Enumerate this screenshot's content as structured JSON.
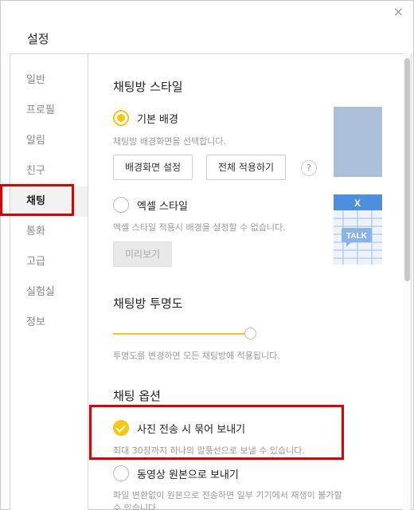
{
  "window": {
    "title": "설정",
    "close_glyph": "×"
  },
  "sidebar": {
    "items": [
      {
        "label": "일반"
      },
      {
        "label": "프로필"
      },
      {
        "label": "알림"
      },
      {
        "label": "친구"
      },
      {
        "label": "채팅",
        "active": true
      },
      {
        "label": "통화"
      },
      {
        "label": "고급"
      },
      {
        "label": "실험실"
      },
      {
        "label": "정보"
      }
    ]
  },
  "style_section": {
    "title": "채팅방 스타일",
    "basic": {
      "label": "기본 배경",
      "selected": true,
      "desc": "채팅방 배경화면을 선택합니다."
    },
    "set_background_button": "배경화면 설정",
    "apply_all_button": "전체 적용하기",
    "help_glyph": "?",
    "excel": {
      "label": "엑셀 스타일",
      "selected": false,
      "desc": "엑셀 스타일 적용시 배경을 설정할 수 없습니다."
    },
    "preview_button": "미리보기",
    "excel_thumb": {
      "header_glyph": "X",
      "talk_text": "TALK"
    }
  },
  "opacity_section": {
    "title": "채팅방 투명도",
    "value_percent": 100,
    "desc": "투명도를 변경하면 모든 채팅방에 적용됩니다."
  },
  "options_section": {
    "title": "채팅 옵션",
    "photo_bundle": {
      "label": "사진 전송 시 묶어 보내기",
      "checked": true,
      "desc": "최대 30장까지 하나의 말풍선으로 보낼 수 있습니다."
    },
    "video_original": {
      "label": "동영상 원본으로 보내기",
      "checked": false,
      "desc_line1": "파일 변환없이 원본으로 전송하면 일부 기기에서 재생이 불가할",
      "desc_line2": "수 있습니다."
    }
  },
  "colors": {
    "accent": "#f9c515",
    "highlight": "#e00000"
  }
}
